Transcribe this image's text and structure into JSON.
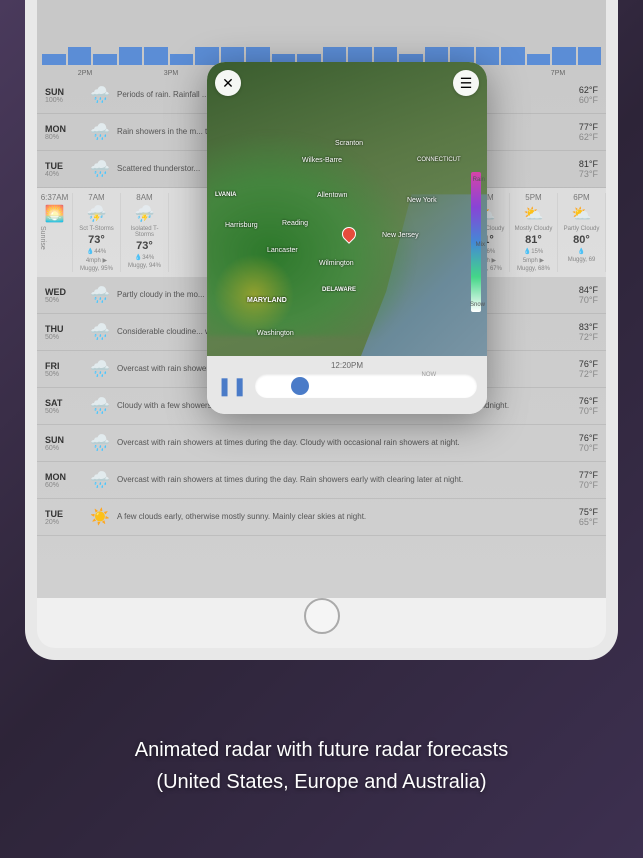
{
  "caption": {
    "line1": "Animated radar with future radar forecasts",
    "line2": "(United States, Europe and Australia)"
  },
  "precip_times": [
    "2PM",
    "3PM",
    "7PM"
  ],
  "daily_top": [
    {
      "day": "SUN",
      "pct": "100%",
      "desc": "Periods of rain. Rainfall ... ain likely. Rainfall near a half an inch at night.",
      "hi": "62°F",
      "lo": "60°F"
    },
    {
      "day": "MON",
      "pct": "80%",
      "desc": "Rain showers in the m... thunderstorms at night ... ds with scattered",
      "hi": "77°F",
      "lo": "62°F"
    },
    {
      "day": "TUE",
      "pct": "40%",
      "desc": "Scattered thunderstor...",
      "hi": "81°F",
      "lo": "73°F"
    }
  ],
  "hourly_sunrise": "6:37AM",
  "hourly": [
    {
      "h": "7AM",
      "c": "Sct T-Storms",
      "t": "73°",
      "p": "44%",
      "w": "4mph ▶",
      "x": "Muggy, 95%"
    },
    {
      "h": "8AM",
      "c": "Isolated T-Storms",
      "t": "73°",
      "p": "34%",
      "w": "",
      "x": "Muggy, 94%"
    },
    {
      "h": "4PM",
      "c": "Mostly Cloudy",
      "t": "81°",
      "p": "16%",
      "w": "6mph ▶",
      "x": "Muggy, 67%"
    },
    {
      "h": "5PM",
      "c": "Mostly Cloudy",
      "t": "81°",
      "p": "15%",
      "w": "5mph ▶",
      "x": "Muggy, 68%"
    },
    {
      "h": "6PM",
      "c": "Partly Cloudy",
      "t": "80°",
      "p": "",
      "w": "",
      "x": "Muggy, 69"
    }
  ],
  "daily_bottom": [
    {
      "day": "WED",
      "pct": "50%",
      "desc": "Partly cloudy in the mo... at night.",
      "hi": "84°F",
      "lo": "70°F"
    },
    {
      "day": "THU",
      "pct": "50%",
      "desc": "Considerable cloudine... wers late at night.",
      "hi": "83°F",
      "lo": "72°F"
    },
    {
      "day": "FRI",
      "pct": "50%",
      "desc": "Overcast with rain showers at times during the day. Considerable cloudiness at night.",
      "hi": "76°F",
      "lo": "72°F"
    },
    {
      "day": "SAT",
      "pct": "50%",
      "desc": "Cloudy with a few showers during the day. Mostly cloudy in the evening then periods of showers after midnight.",
      "hi": "76°F",
      "lo": "70°F"
    },
    {
      "day": "SUN",
      "pct": "60%",
      "desc": "Overcast with rain showers at times during the day. Cloudy with occasional rain showers at night.",
      "hi": "76°F",
      "lo": "70°F"
    },
    {
      "day": "MON",
      "pct": "60%",
      "desc": "Overcast with rain showers at times during the day. Rain showers early with clearing later at night.",
      "hi": "77°F",
      "lo": "70°F"
    },
    {
      "day": "TUE",
      "pct": "20%",
      "desc": "A few clouds early, otherwise mostly sunny. Mainly clear skies at night.",
      "hi": "75°F",
      "lo": "65°F"
    }
  ],
  "radar": {
    "timestamp": "12:20PM",
    "now": "NOW",
    "cities": [
      "New York",
      "New Jersey",
      "CONNECTICUT",
      "MARYLAND",
      "DELAWARE",
      "Washington",
      "Wilmington",
      "Lancaster",
      "Harrisburg",
      "Allentown",
      "Reading",
      "LVANIA",
      "Scranton",
      "Wilkes-Barre"
    ],
    "legend": {
      "top": "Rain",
      "mid": "Mix",
      "bot": "Snow"
    }
  },
  "sunrise_label": "Sunrise"
}
